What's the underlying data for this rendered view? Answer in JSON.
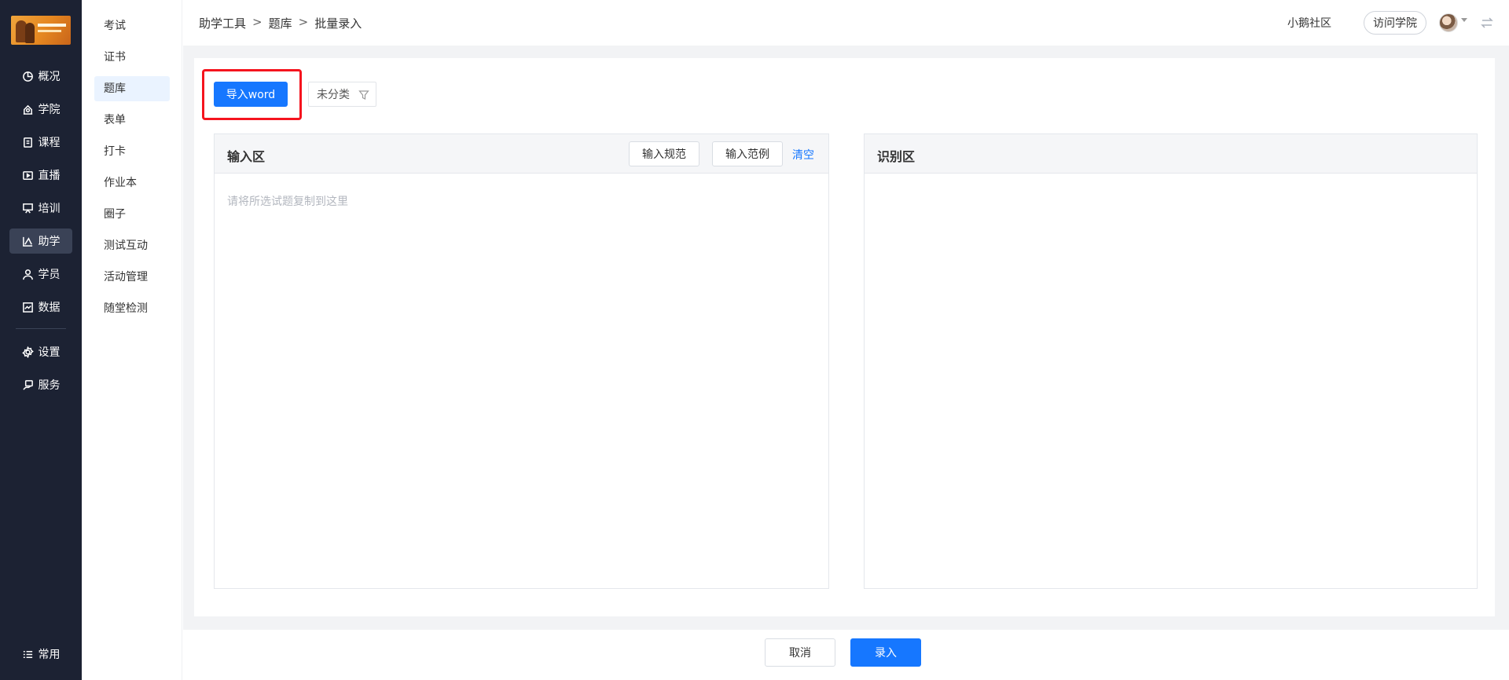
{
  "nav": {
    "items": [
      {
        "label": "概况",
        "icon": "pie-chart-icon"
      },
      {
        "label": "学院",
        "icon": "academy-icon"
      },
      {
        "label": "课程",
        "icon": "course-icon"
      },
      {
        "label": "直播",
        "icon": "live-icon"
      },
      {
        "label": "培训",
        "icon": "training-icon"
      },
      {
        "label": "助学",
        "icon": "study-aid-icon",
        "active": true
      },
      {
        "label": "学员",
        "icon": "student-icon"
      },
      {
        "label": "数据",
        "icon": "data-icon"
      },
      {
        "label": "设置",
        "icon": "settings-icon"
      },
      {
        "label": "服务",
        "icon": "service-icon"
      }
    ],
    "bottom": {
      "label": "常用",
      "icon": "list-icon"
    }
  },
  "submenu": {
    "items": [
      {
        "label": "考试"
      },
      {
        "label": "证书"
      },
      {
        "label": "题库",
        "active": true
      },
      {
        "label": "表单"
      },
      {
        "label": "打卡"
      },
      {
        "label": "作业本"
      },
      {
        "label": "圈子"
      },
      {
        "label": "测试互动"
      },
      {
        "label": "活动管理"
      },
      {
        "label": "随堂检测"
      }
    ]
  },
  "breadcrumb": {
    "items": [
      "助学工具",
      "题库",
      "批量录入"
    ],
    "separator": ">"
  },
  "topbar": {
    "community_link": "小鹅社区",
    "visit_button": "访问学院"
  },
  "toolbar": {
    "import_button": "导入word",
    "category_value": "未分类"
  },
  "input_panel": {
    "title": "输入区",
    "spec_button": "输入规范",
    "example_button": "输入范例",
    "clear_link": "清空",
    "placeholder": "请将所选试题复制到这里"
  },
  "result_panel": {
    "title": "识别区"
  },
  "footer": {
    "cancel_button": "取消",
    "submit_button": "录入"
  },
  "colors": {
    "nav_bg": "#1c2233",
    "primary": "#1677ff",
    "highlight": "#f5141e"
  }
}
